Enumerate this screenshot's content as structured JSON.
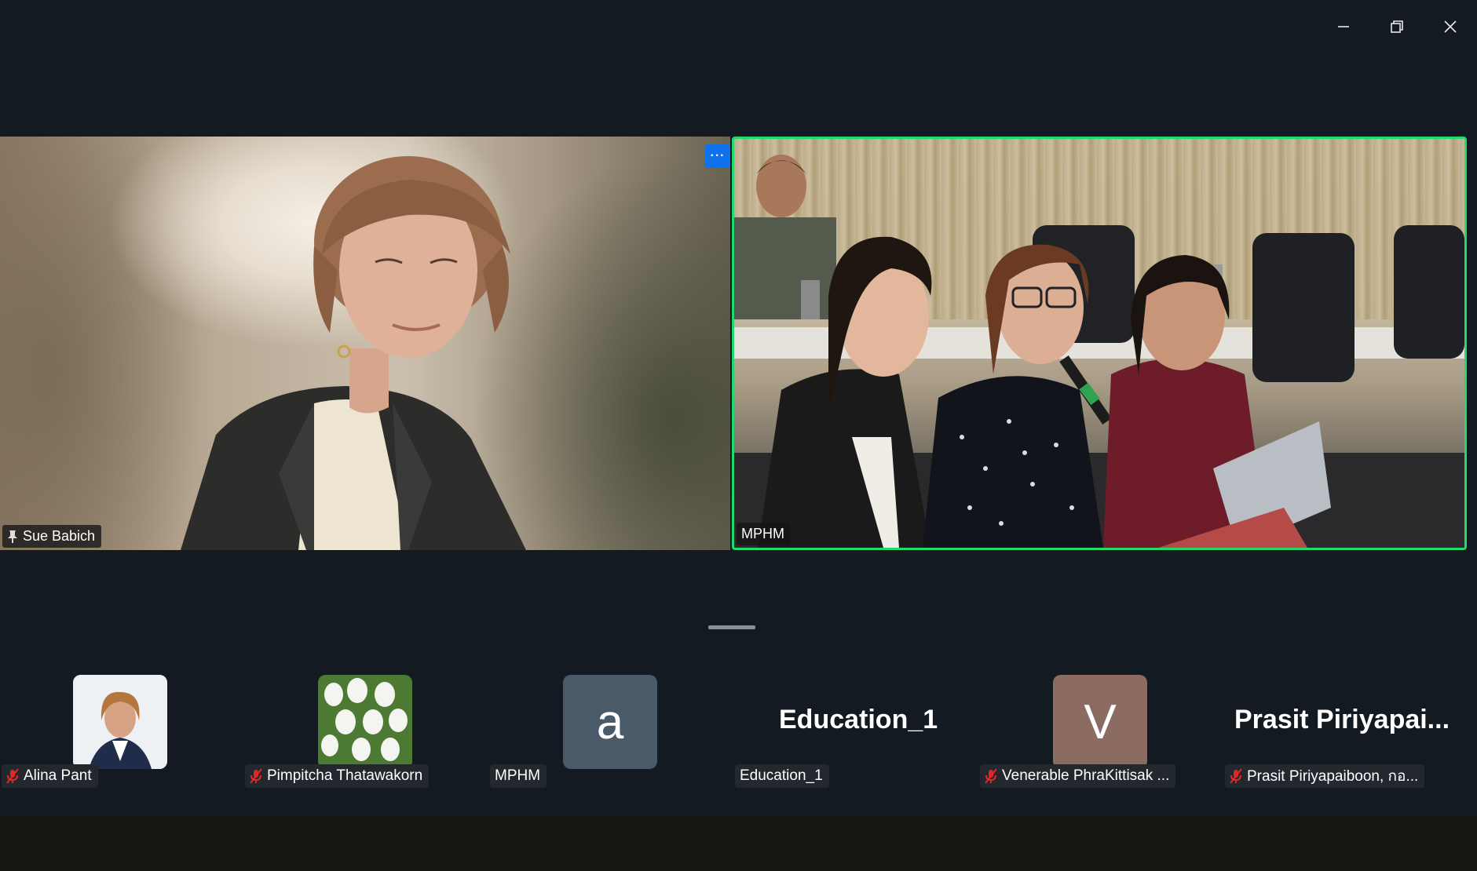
{
  "window_controls": {
    "minimize_icon": "minimize-icon",
    "restore_icon": "restore-icon",
    "close_icon": "close-icon"
  },
  "main_tiles": [
    {
      "name": "Sue Babich",
      "pinned": true,
      "pin_icon": "pin-icon"
    },
    {
      "name": "MPHM",
      "active_speaker": true,
      "accent": "#23d96b"
    }
  ],
  "more_button": {
    "label": "···",
    "color": "#0e72ed"
  },
  "gallery": [
    {
      "label": "Alina Pant",
      "muted": true,
      "avatar_type": "photo"
    },
    {
      "label": "Pimpitcha Thatawakorn",
      "muted": true,
      "avatar_type": "photo"
    },
    {
      "label": "MPHM",
      "muted": false,
      "avatar_letter": "a",
      "avatar_color": "#4a5a68"
    },
    {
      "label": "Education_1",
      "muted": false,
      "big_name": "Education_1"
    },
    {
      "label": "Venerable PhraKittisak ...",
      "muted": true,
      "avatar_letter": "V",
      "avatar_color": "#8c6b61"
    },
    {
      "label": "Prasit Piriyapaiboon, กอ...",
      "muted": true,
      "big_name": "Prasit  Piriyapai..."
    }
  ],
  "mic_muted_icon": "mic-muted-icon"
}
